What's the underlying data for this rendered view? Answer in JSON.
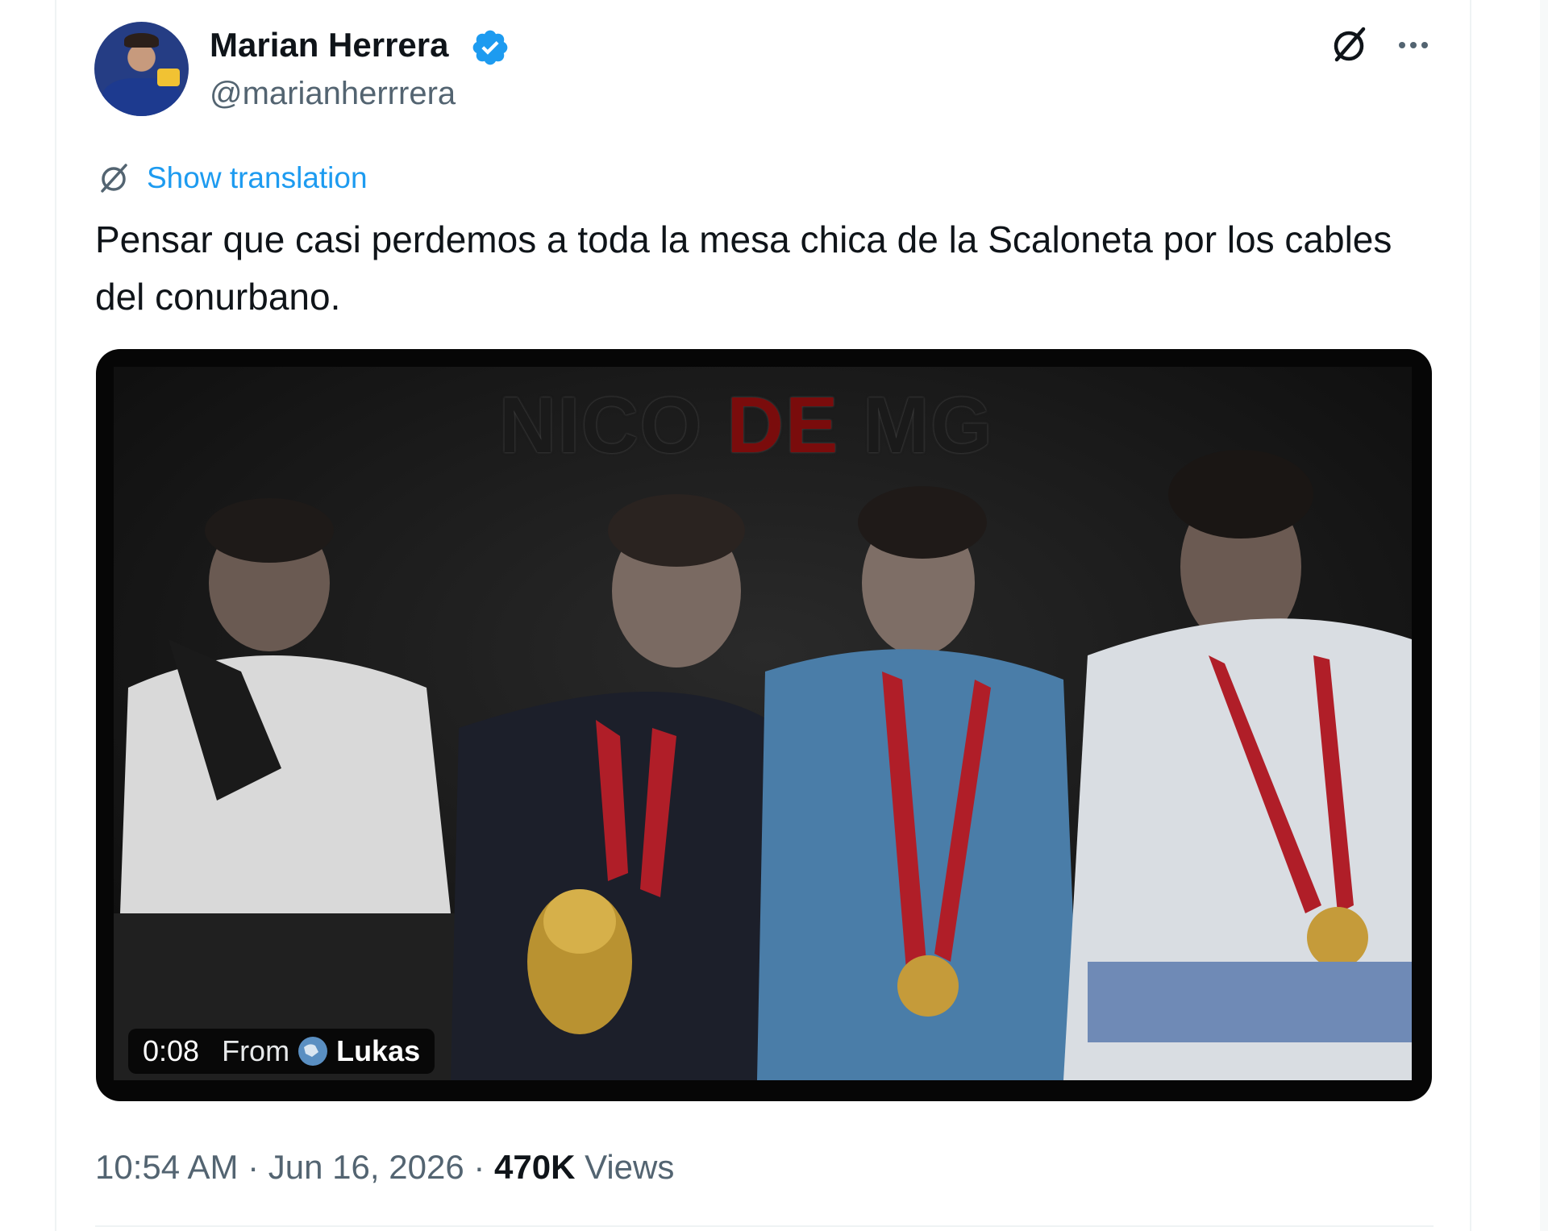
{
  "author": {
    "name": "Marian Herrera",
    "handle": "@marianherrrera",
    "verified": true,
    "avatar_icon": "avatar-photo"
  },
  "actions": {
    "grok_icon": "grok-icon",
    "more_icon": "more-icon"
  },
  "translation": {
    "label": "Show translation",
    "icon": "grok-icon"
  },
  "tweet": {
    "text": "Pensar que casi perdemos a toda la mesa chica de la Scaloneta por los cables del conurbano."
  },
  "media": {
    "watermark_part1": "NICO ",
    "watermark_part2": "DE",
    "watermark_part3": " MG",
    "duration": "0:08",
    "from_label": "From",
    "source_name": "Lukas"
  },
  "meta": {
    "time": "10:54 AM",
    "sep1": " · ",
    "date": "Jun 16, 2026",
    "sep2": " · ",
    "views_count": "470K",
    "views_label": " Views"
  },
  "colors": {
    "link": "#1d9bf0",
    "verified": "#1d9bf0",
    "secondary_text": "#536471",
    "primary_text": "#0f1419"
  }
}
